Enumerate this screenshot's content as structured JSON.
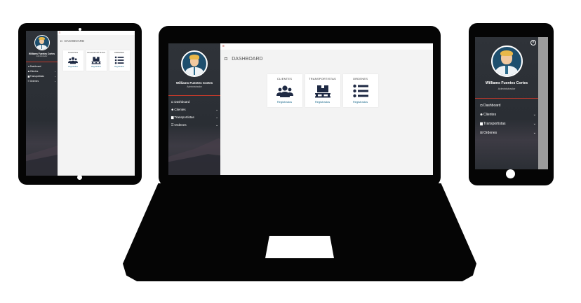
{
  "user": {
    "name": "Williams Fuentes Cortes",
    "role": "Administrador"
  },
  "page": {
    "title": "DASHBOARD",
    "menu_icon": "≡"
  },
  "menu": [
    {
      "label": "Dashboard",
      "icon": "dashboard-icon",
      "chevron": ""
    },
    {
      "label": "Clientes",
      "icon": "users-icon",
      "chevron": "⌄"
    },
    {
      "label": "Transportistas",
      "icon": "truck-icon",
      "chevron": "⌄"
    },
    {
      "label": "Ordenes",
      "icon": "list-icon",
      "chevron": "⌄"
    }
  ],
  "cards": [
    {
      "title": "CLIENTES",
      "link": "Registrados",
      "icon": "users-icon"
    },
    {
      "title": "TRANSPORTISTAS",
      "link": "Registrados",
      "icon": "pallet-icon"
    },
    {
      "title": "ORDENES",
      "link": "Registrados",
      "icon": "list-icon"
    }
  ],
  "colors": {
    "sidebar": "#2f3339",
    "accent": "#c0392b",
    "link": "#1e6b8c",
    "icon": "#1f2a44",
    "content_bg": "#f3f3f3"
  },
  "close_glyph": "×"
}
